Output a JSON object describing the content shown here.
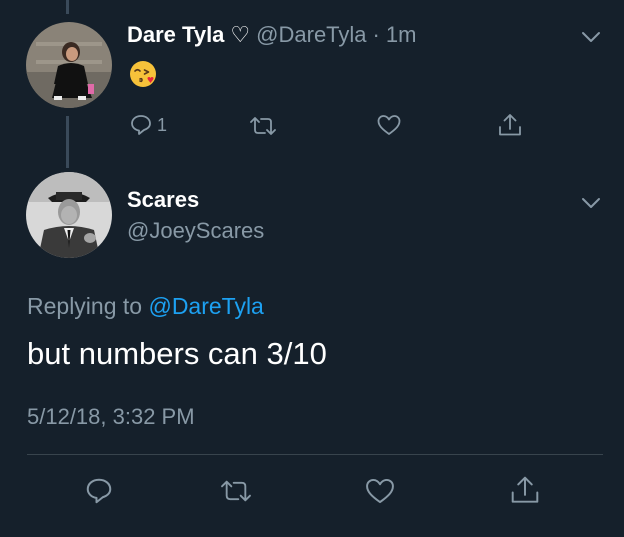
{
  "parent_tweet": {
    "display_name": "Dare Tyla",
    "heart_glyph": "♡",
    "handle": "@DareTyla",
    "separator": "·",
    "time": "1m",
    "body_emoji": "kissing-face-with-heart-emoji",
    "reply_count": "1",
    "icons": [
      "reply-icon",
      "retweet-icon",
      "like-icon",
      "share-icon",
      "chevron-down-icon"
    ]
  },
  "reply_tweet": {
    "display_name": "Scares",
    "handle": "@JoeyScares",
    "replying_prefix": "Replying to",
    "replying_to": "@DareTyla",
    "text": "but numbers can 3/10",
    "timestamp": "5/12/18, 3:32 PM",
    "icons": [
      "reply-icon",
      "retweet-icon",
      "like-icon",
      "share-icon",
      "chevron-down-icon"
    ]
  },
  "colors": {
    "background": "#15202b",
    "text_primary": "#ffffff",
    "text_secondary": "#8899a6",
    "link": "#1da1f2",
    "divider": "#38444d"
  }
}
